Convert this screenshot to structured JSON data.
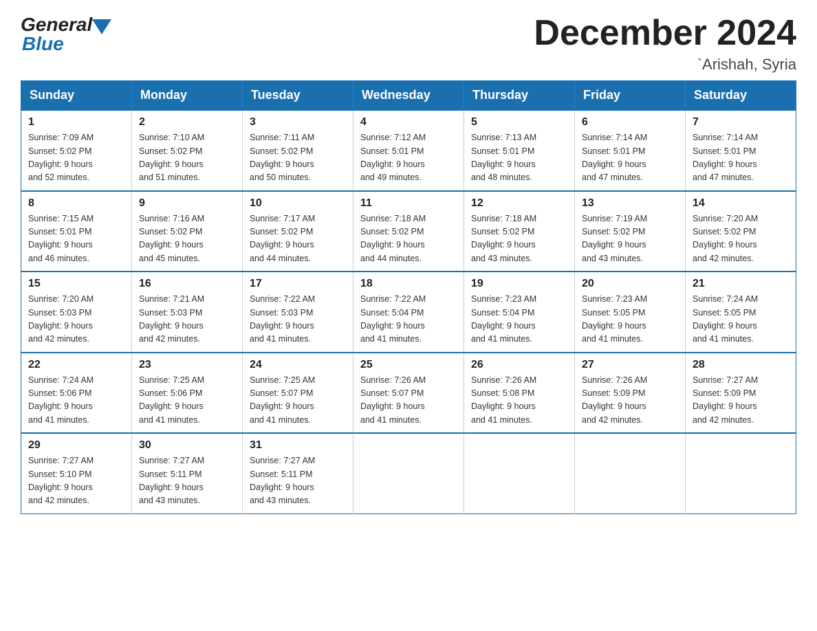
{
  "logo": {
    "general": "General",
    "blue": "Blue"
  },
  "header": {
    "month": "December 2024",
    "location": "`Arishah, Syria"
  },
  "weekdays": [
    "Sunday",
    "Monday",
    "Tuesday",
    "Wednesday",
    "Thursday",
    "Friday",
    "Saturday"
  ],
  "weeks": [
    [
      {
        "day": "1",
        "sunrise": "7:09 AM",
        "sunset": "5:02 PM",
        "daylight": "9 hours and 52 minutes."
      },
      {
        "day": "2",
        "sunrise": "7:10 AM",
        "sunset": "5:02 PM",
        "daylight": "9 hours and 51 minutes."
      },
      {
        "day": "3",
        "sunrise": "7:11 AM",
        "sunset": "5:02 PM",
        "daylight": "9 hours and 50 minutes."
      },
      {
        "day": "4",
        "sunrise": "7:12 AM",
        "sunset": "5:01 PM",
        "daylight": "9 hours and 49 minutes."
      },
      {
        "day": "5",
        "sunrise": "7:13 AM",
        "sunset": "5:01 PM",
        "daylight": "9 hours and 48 minutes."
      },
      {
        "day": "6",
        "sunrise": "7:14 AM",
        "sunset": "5:01 PM",
        "daylight": "9 hours and 47 minutes."
      },
      {
        "day": "7",
        "sunrise": "7:14 AM",
        "sunset": "5:01 PM",
        "daylight": "9 hours and 47 minutes."
      }
    ],
    [
      {
        "day": "8",
        "sunrise": "7:15 AM",
        "sunset": "5:01 PM",
        "daylight": "9 hours and 46 minutes."
      },
      {
        "day": "9",
        "sunrise": "7:16 AM",
        "sunset": "5:02 PM",
        "daylight": "9 hours and 45 minutes."
      },
      {
        "day": "10",
        "sunrise": "7:17 AM",
        "sunset": "5:02 PM",
        "daylight": "9 hours and 44 minutes."
      },
      {
        "day": "11",
        "sunrise": "7:18 AM",
        "sunset": "5:02 PM",
        "daylight": "9 hours and 44 minutes."
      },
      {
        "day": "12",
        "sunrise": "7:18 AM",
        "sunset": "5:02 PM",
        "daylight": "9 hours and 43 minutes."
      },
      {
        "day": "13",
        "sunrise": "7:19 AM",
        "sunset": "5:02 PM",
        "daylight": "9 hours and 43 minutes."
      },
      {
        "day": "14",
        "sunrise": "7:20 AM",
        "sunset": "5:02 PM",
        "daylight": "9 hours and 42 minutes."
      }
    ],
    [
      {
        "day": "15",
        "sunrise": "7:20 AM",
        "sunset": "5:03 PM",
        "daylight": "9 hours and 42 minutes."
      },
      {
        "day": "16",
        "sunrise": "7:21 AM",
        "sunset": "5:03 PM",
        "daylight": "9 hours and 42 minutes."
      },
      {
        "day": "17",
        "sunrise": "7:22 AM",
        "sunset": "5:03 PM",
        "daylight": "9 hours and 41 minutes."
      },
      {
        "day": "18",
        "sunrise": "7:22 AM",
        "sunset": "5:04 PM",
        "daylight": "9 hours and 41 minutes."
      },
      {
        "day": "19",
        "sunrise": "7:23 AM",
        "sunset": "5:04 PM",
        "daylight": "9 hours and 41 minutes."
      },
      {
        "day": "20",
        "sunrise": "7:23 AM",
        "sunset": "5:05 PM",
        "daylight": "9 hours and 41 minutes."
      },
      {
        "day": "21",
        "sunrise": "7:24 AM",
        "sunset": "5:05 PM",
        "daylight": "9 hours and 41 minutes."
      }
    ],
    [
      {
        "day": "22",
        "sunrise": "7:24 AM",
        "sunset": "5:06 PM",
        "daylight": "9 hours and 41 minutes."
      },
      {
        "day": "23",
        "sunrise": "7:25 AM",
        "sunset": "5:06 PM",
        "daylight": "9 hours and 41 minutes."
      },
      {
        "day": "24",
        "sunrise": "7:25 AM",
        "sunset": "5:07 PM",
        "daylight": "9 hours and 41 minutes."
      },
      {
        "day": "25",
        "sunrise": "7:26 AM",
        "sunset": "5:07 PM",
        "daylight": "9 hours and 41 minutes."
      },
      {
        "day": "26",
        "sunrise": "7:26 AM",
        "sunset": "5:08 PM",
        "daylight": "9 hours and 41 minutes."
      },
      {
        "day": "27",
        "sunrise": "7:26 AM",
        "sunset": "5:09 PM",
        "daylight": "9 hours and 42 minutes."
      },
      {
        "day": "28",
        "sunrise": "7:27 AM",
        "sunset": "5:09 PM",
        "daylight": "9 hours and 42 minutes."
      }
    ],
    [
      {
        "day": "29",
        "sunrise": "7:27 AM",
        "sunset": "5:10 PM",
        "daylight": "9 hours and 42 minutes."
      },
      {
        "day": "30",
        "sunrise": "7:27 AM",
        "sunset": "5:11 PM",
        "daylight": "9 hours and 43 minutes."
      },
      {
        "day": "31",
        "sunrise": "7:27 AM",
        "sunset": "5:11 PM",
        "daylight": "9 hours and 43 minutes."
      },
      null,
      null,
      null,
      null
    ]
  ]
}
